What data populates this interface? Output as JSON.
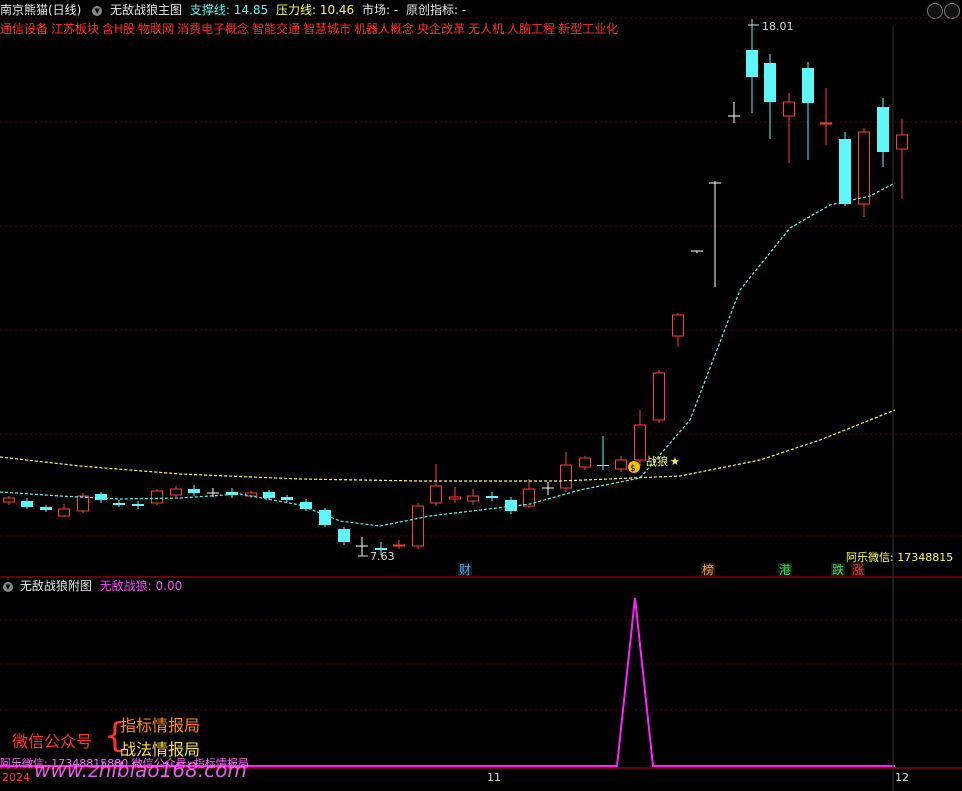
{
  "header": {
    "stock_name": "南京熊猫(日线)",
    "main_indicator": "无敌战狼主图",
    "support_label": "支撑线:",
    "support_value": "14.85",
    "pressure_label": "压力线:",
    "pressure_value": "10.46",
    "market_label": "市场:",
    "market_value": "-",
    "original_label": "原创指标:",
    "original_value": "-"
  },
  "concepts": [
    "通信设备",
    "江苏板块",
    "含H股",
    "物联网",
    "消费电子概念",
    "智能交通",
    "智慧城市",
    "机器人概念",
    "央企改革",
    "无人机",
    "人脑工程",
    "新型工业化"
  ],
  "main_chart": {
    "high_label": "18.01",
    "low_label": "7.63",
    "signal_label": "战狼",
    "signal_coin": "$",
    "contact": "阿乐微信: 17348815",
    "events": [
      {
        "text": "财",
        "color": "#4aa8ff"
      },
      {
        "text": "榜",
        "color": "#ff9a3c"
      },
      {
        "text": "港",
        "color": "#33dd55"
      },
      {
        "text": "跌",
        "color": "#33dd55"
      },
      {
        "text": "涨",
        "color": "#ff3333"
      }
    ],
    "colors": {
      "up": "#ff3b3b",
      "down": "#5ef7f7",
      "flat": "#ffffff",
      "support_line": "#ffff55",
      "trend_line": "#5ef7f7"
    }
  },
  "sub_chart": {
    "title": "无敌战狼附图",
    "indicator_label": "无敌战狼:",
    "indicator_value": "0.00",
    "line_color": "#ff22ff"
  },
  "watermark": {
    "wechat_label": "微信公众号",
    "brand1": "指标情报局",
    "brand2": "战法情报局",
    "url": "www.zhibiao168.com",
    "contact_line": "阿乐微信: 17348815880  微信公众号: 指标情报局"
  },
  "xaxis": {
    "labels": [
      "2024",
      "11",
      "12"
    ]
  }
}
